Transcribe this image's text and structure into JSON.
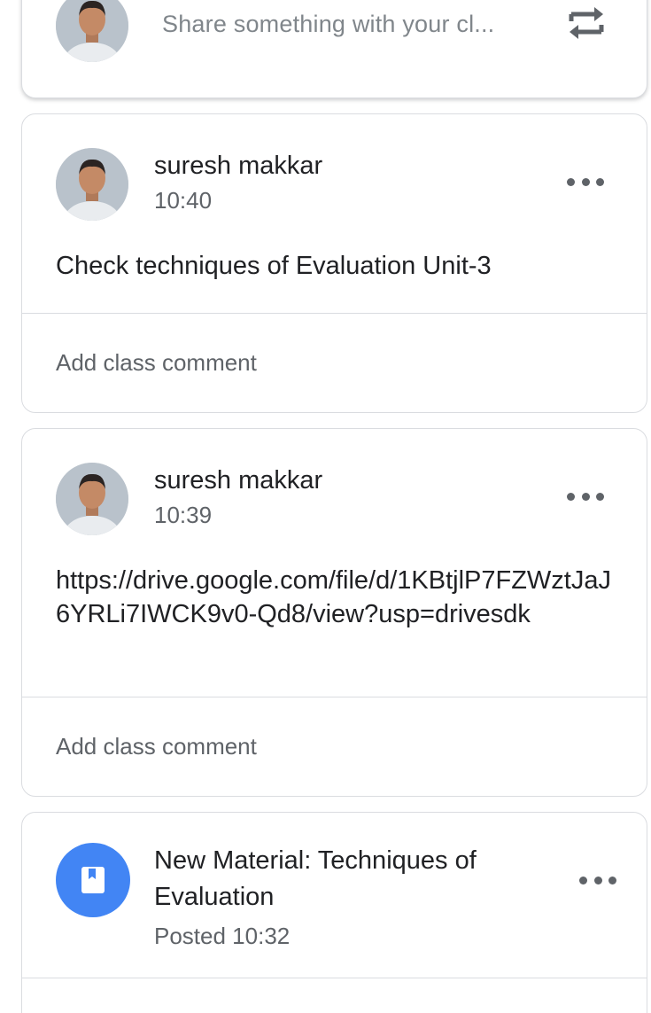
{
  "share": {
    "placeholder": "Share something with your cl...",
    "avatar_icon": "user-avatar",
    "repost_icon": "repost-icon"
  },
  "posts": [
    {
      "author": "suresh makkar",
      "time": "10:40",
      "body": "Check techniques of Evaluation Unit-3",
      "comment_placeholder": "Add class comment"
    },
    {
      "author": "suresh makkar",
      "time": "10:39",
      "body": "https://drive.google.com/file/d/1KBtjlP7FZWztJaJ6YRLi7IWCK9v0-Qd8/view?usp=drivesdk",
      "comment_placeholder": "Add class comment"
    }
  ],
  "material": {
    "title": "New Material: Techniques of Evaluation",
    "posted": "Posted 10:32",
    "icon": "book-icon",
    "accent": "#4285f4"
  },
  "colors": {
    "border": "#dadce0",
    "secondary_text": "#5f6368",
    "primary_text": "#202124"
  }
}
